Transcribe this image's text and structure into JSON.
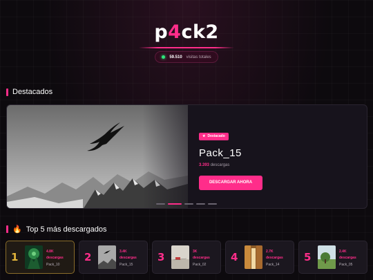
{
  "header": {
    "logo_prefix": "p",
    "logo_accent": "4",
    "logo_suffix": "ck2",
    "visits_count": "59.510",
    "visits_label": "visitas totales"
  },
  "featured_section": {
    "title": "Destacados",
    "badge": "Destacado",
    "pack_title": "Pack_15",
    "downloads_count": "3.393",
    "downloads_label": "descargas",
    "cta_label": "DESCARGAR AHORA",
    "active_slide": 2,
    "slide_count": 5
  },
  "top_section": {
    "icon": "🔥",
    "title": "Top 5 más descargados",
    "items": [
      {
        "rank": "1",
        "count": "4.8K",
        "label": "descargas",
        "name": "Pack_10"
      },
      {
        "rank": "2",
        "count": "3.4K",
        "label": "descargas",
        "name": "Pack_15"
      },
      {
        "rank": "3",
        "count": "3K",
        "label": "descargas",
        "name": "Pack_02"
      },
      {
        "rank": "4",
        "count": "2.7K",
        "label": "descargas",
        "name": "Pack_14"
      },
      {
        "rank": "5",
        "count": "2.4K",
        "label": "descargas",
        "name": "Pack_05"
      }
    ]
  },
  "colors": {
    "accent": "#ff2d8a",
    "gold": "#e2b43a",
    "online": "#2ee67a",
    "background": "#0d0a0e"
  }
}
